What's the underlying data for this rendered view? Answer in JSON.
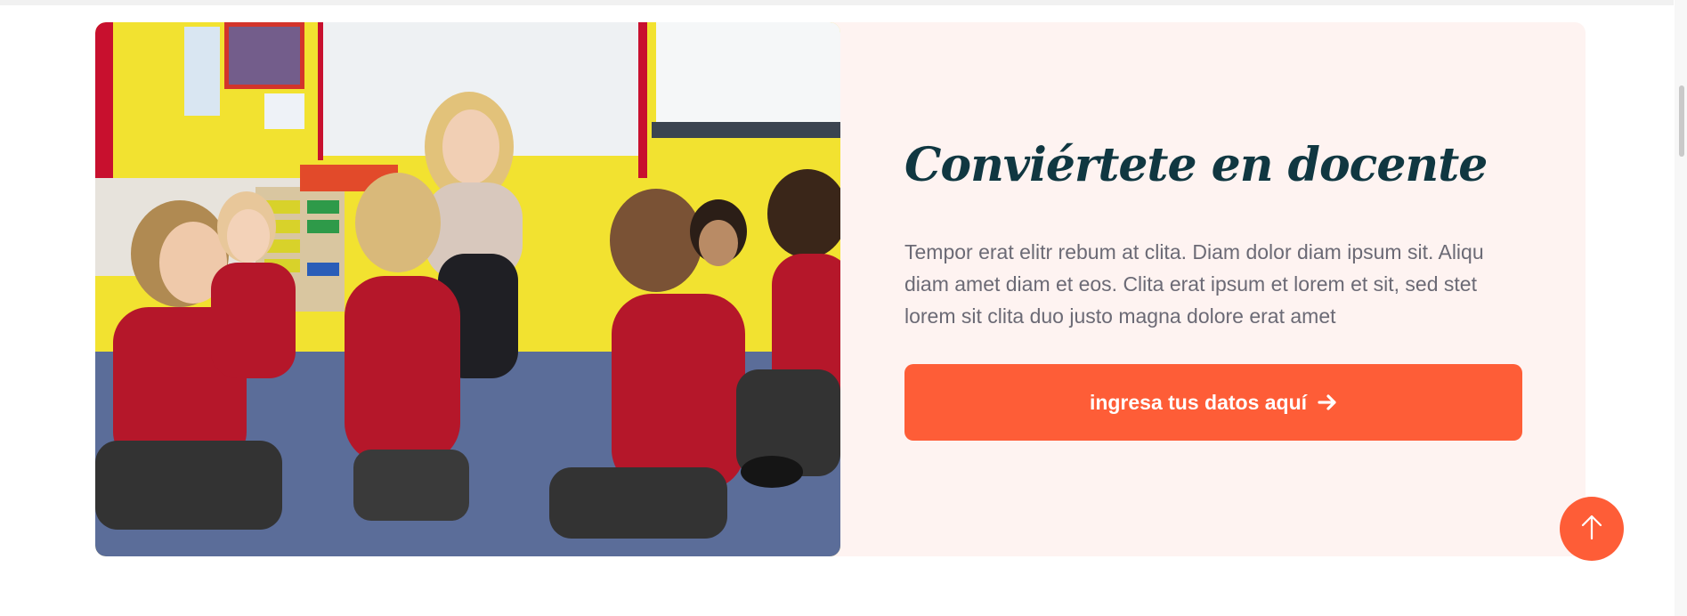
{
  "colors": {
    "accent": "#fe5d37",
    "card_background": "#fef3f1",
    "title": "#103741",
    "body_text": "#6b6a75"
  },
  "image": {
    "subject": "teacher with schoolchildren in red uniforms sitting in a circle in a classroom"
  },
  "cta_section": {
    "title": "Conviértete en docente",
    "description": "Tempor erat elitr rebum at clita. Diam dolor diam ipsum sit. Aliqu diam amet diam et eos. Clita erat ipsum et lorem et sit, sed stet lorem sit clita duo justo magna dolore erat amet",
    "button_label": "ingresa tus datos aquí",
    "button_icon": "arrow-right-icon"
  },
  "back_to_top": {
    "icon": "arrow-up-icon"
  }
}
